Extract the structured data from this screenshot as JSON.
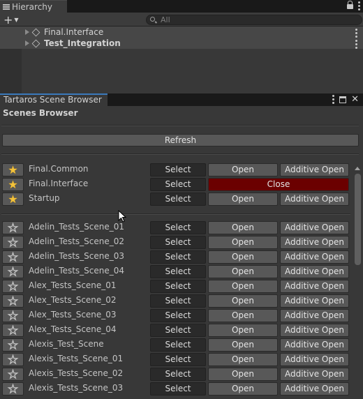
{
  "hierarchy": {
    "tab_label": "Hierarchy",
    "add_label": "+",
    "search_placeholder": "All",
    "rows": [
      {
        "name": "Final.Interface"
      },
      {
        "name": "Test_Integration"
      }
    ]
  },
  "browser": {
    "tab_label": "Tartaros Scene Browser",
    "title": "Scenes Browser",
    "refresh_label": "Refresh",
    "favorites": [
      {
        "name": "Final.Common",
        "select": "Select",
        "open": "Open",
        "additive": "Additive Open",
        "starred": true
      },
      {
        "name": "Final.Interface",
        "select": "Select",
        "close": "Close",
        "starred": true
      },
      {
        "name": "Startup",
        "select": "Select",
        "open": "Open",
        "additive": "Additive Open",
        "starred": true
      }
    ],
    "scenes": [
      {
        "name": "Adelin_Tests_Scene_01",
        "select": "Select",
        "open": "Open",
        "additive": "Additive Open"
      },
      {
        "name": "Adelin_Tests_Scene_02",
        "select": "Select",
        "open": "Open",
        "additive": "Additive Open"
      },
      {
        "name": "Adelin_Tests_Scene_03",
        "select": "Select",
        "open": "Open",
        "additive": "Additive Open"
      },
      {
        "name": "Adelin_Tests_Scene_04",
        "select": "Select",
        "open": "Open",
        "additive": "Additive Open"
      },
      {
        "name": "Alex_Tests_Scene_01",
        "select": "Select",
        "open": "Open",
        "additive": "Additive Open"
      },
      {
        "name": "Alex_Tests_Scene_02",
        "select": "Select",
        "open": "Open",
        "additive": "Additive Open"
      },
      {
        "name": "Alex_Tests_Scene_03",
        "select": "Select",
        "open": "Open",
        "additive": "Additive Open"
      },
      {
        "name": "Alex_Tests_Scene_04",
        "select": "Select",
        "open": "Open",
        "additive": "Additive Open"
      },
      {
        "name": "Alexis_Test_Scene",
        "select": "Select",
        "open": "Open",
        "additive": "Additive Open"
      },
      {
        "name": "Alexis_Tests_Scene_01",
        "select": "Select",
        "open": "Open",
        "additive": "Additive Open"
      },
      {
        "name": "Alexis_Tests_Scene_02",
        "select": "Select",
        "open": "Open",
        "additive": "Additive Open"
      },
      {
        "name": "Alexis_Tests_Scene_03",
        "select": "Select",
        "open": "Open",
        "additive": "Additive Open"
      }
    ]
  },
  "icons": {
    "star_filled": "star-filled-icon",
    "star_empty": "star-outline-icon",
    "lock": "lock-icon",
    "menu": "kebab-menu-icon",
    "search": "search-icon",
    "unity_scene": "unity-scene-icon"
  },
  "colors": {
    "accent_tab": "#3a79bb",
    "close_button": "#6b0000",
    "star": "#f3c23a"
  }
}
